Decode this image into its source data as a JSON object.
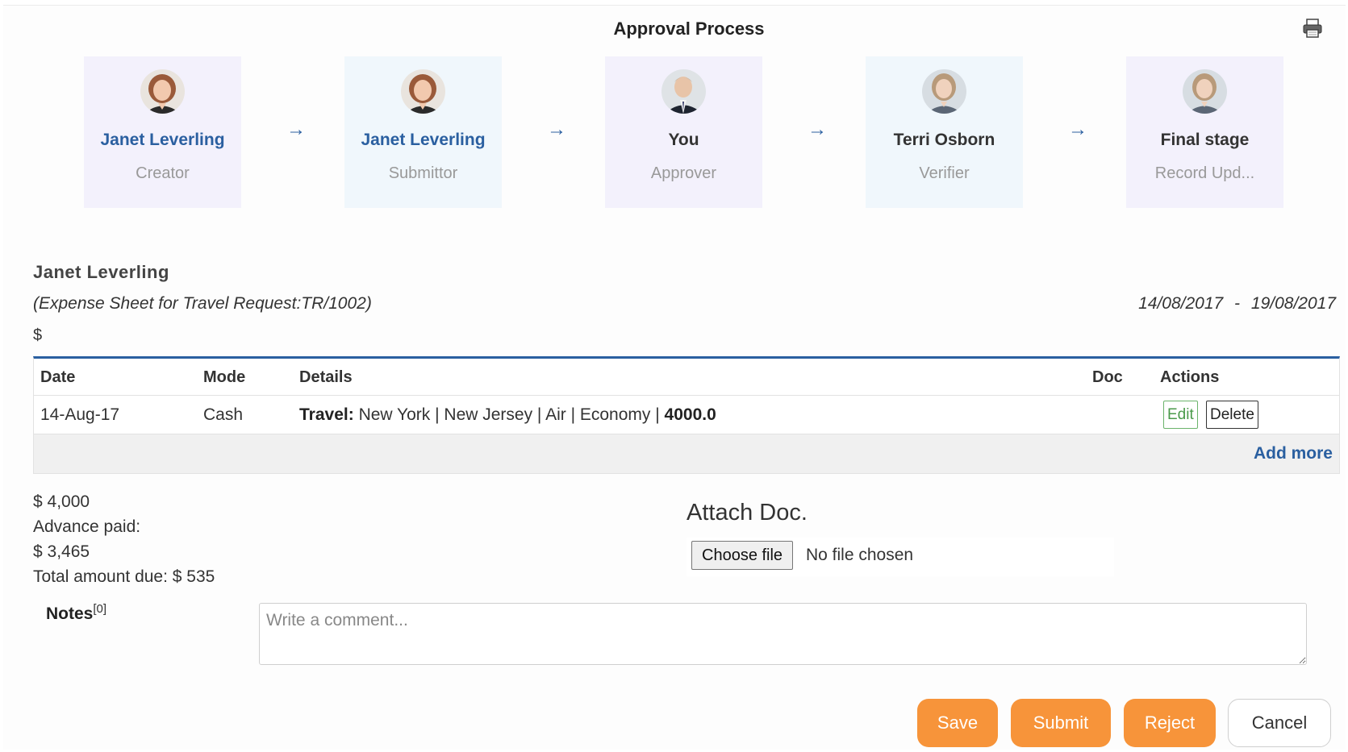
{
  "header": {
    "title": "Approval Process",
    "print_icon": "printer-icon"
  },
  "steps": [
    {
      "name": "Janet Leverling",
      "role": "Creator",
      "avatar": "woman-red-hair"
    },
    {
      "name": "Janet Leverling",
      "role": "Submittor",
      "avatar": "woman-red-hair"
    },
    {
      "name": "You",
      "role": "Approver",
      "avatar": "man-suit"
    },
    {
      "name": "Terri Osborn",
      "role": "Verifier",
      "avatar": "woman-gray"
    },
    {
      "name": "Final stage",
      "role": "Record Upd...",
      "avatar": "woman-gray"
    }
  ],
  "arrow_glyph": "→",
  "request": {
    "employee": "Janet Leverling",
    "subtitle": "(Expense Sheet for Travel Request:TR/1002)",
    "from_date": "14/08/2017",
    "date_sep": "-",
    "to_date": "19/08/2017",
    "currency": "$"
  },
  "table": {
    "headers": {
      "date": "Date",
      "mode": "Mode",
      "details": "Details",
      "doc": "Doc",
      "actions": "Actions"
    },
    "rows": [
      {
        "date": "14-Aug-17",
        "mode": "Cash",
        "details_label": "Travel:",
        "details_text": "New York | New Jersey | Air | Economy |",
        "details_amount": "4000.0",
        "edit": "Edit",
        "delete": "Delete"
      }
    ],
    "add_more": "Add more"
  },
  "summary": {
    "total": "$ 4,000",
    "advance_label": "Advance paid:",
    "advance": "$ 3,465",
    "due": "Total amount due: $ 535"
  },
  "attach": {
    "title": "Attach Doc.",
    "button": "Choose file",
    "status": "No file chosen"
  },
  "notes": {
    "label": "Notes",
    "count": "[0]",
    "placeholder": "Write a comment..."
  },
  "actions": {
    "save": "Save",
    "submit": "Submit",
    "reject": "Reject",
    "cancel": "Cancel"
  },
  "colors": {
    "accent": "#2a5fa0",
    "orange": "#f7943a",
    "edit_green": "#4a9a4a"
  }
}
